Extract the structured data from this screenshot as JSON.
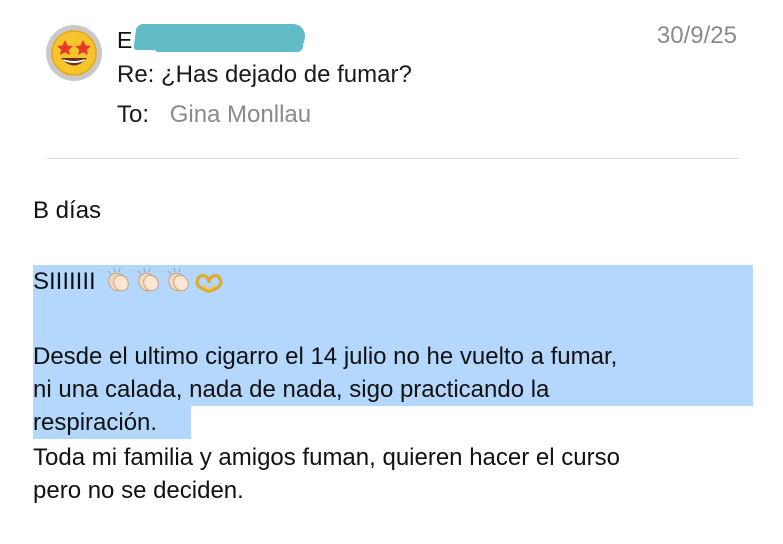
{
  "header": {
    "sender_initial": "E",
    "date": "30/9/25",
    "subject": "Re: ¿Has dejado de fumar?",
    "to_label": "To:",
    "to_value": "Gina Monllau"
  },
  "avatar": {
    "icon": "star-struck-emoji-icon"
  },
  "body": {
    "greeting": "B días",
    "line1": "SIIIIIII",
    "line1_icons": [
      "clapping-hands-icon",
      "clapping-hands-icon",
      "clapping-hands-icon",
      "heart-hands-icon"
    ],
    "line2": "Desde el ultimo cigarro el 14 julio no he vuelto a fumar,",
    "line3": "ni una calada, nada de nada, sigo practicando la",
    "line4": "respiración.",
    "line5": "Toda mi familia y amigos fuman, quieren hacer el curso",
    "line6": "pero no se deciden."
  },
  "colors": {
    "highlight": "#b3d7fd",
    "redaction": "#62bcc6",
    "secondary_text": "#8a8a8a"
  }
}
